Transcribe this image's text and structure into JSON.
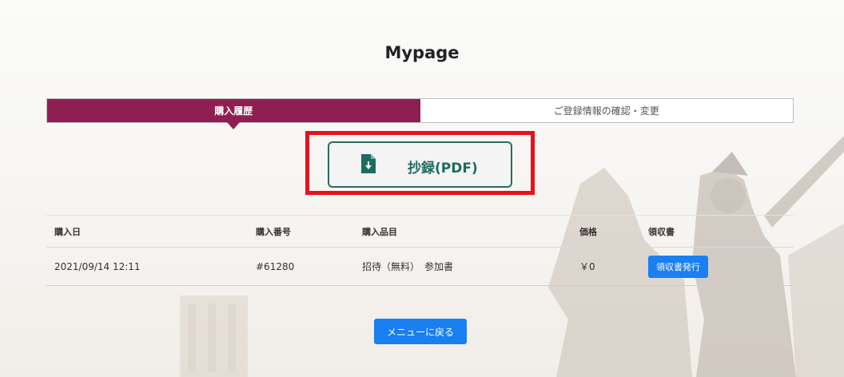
{
  "page": {
    "title": "Mypage"
  },
  "tabs": [
    {
      "label": "購入履歴",
      "active": true
    },
    {
      "label": "ご登録情報の確認・変更",
      "active": false
    }
  ],
  "pdf_button": {
    "label": "抄録(PDF)",
    "icon": "file-download-icon"
  },
  "table": {
    "headers": [
      "購入日",
      "購入番号",
      "購入品目",
      "価格",
      "領収書"
    ],
    "rows": [
      {
        "date": "2021/09/14 12:11",
        "number": "#61280",
        "item": "招待（無料）　参加書",
        "price": "￥0",
        "receipt_label": "領収書発行"
      }
    ]
  },
  "menu_button": {
    "label": "メニューに戻る"
  },
  "colors": {
    "accent": "#8f1f52",
    "primary": "#1a7ff0",
    "pdf_border": "#2a6b63",
    "highlight": "#e8121a"
  }
}
